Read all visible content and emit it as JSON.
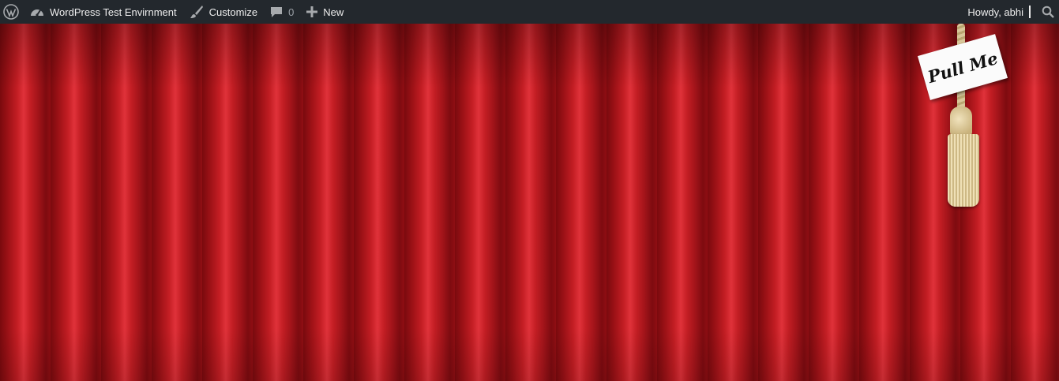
{
  "adminbar": {
    "site_name": "WordPress Test Envirnment",
    "customize_label": "Customize",
    "comments_count": "0",
    "new_label": "New",
    "howdy_text": "Howdy, abhi",
    "icons": [
      "wordpress-logo-icon",
      "dashboard-icon",
      "brush-icon",
      "comment-icon",
      "plus-icon",
      "search-icon"
    ]
  },
  "curtain": {
    "sign_text": "Pull Me"
  },
  "colors": {
    "adminbar_bg": "#23282d",
    "curtain_red": "#c41e24"
  }
}
